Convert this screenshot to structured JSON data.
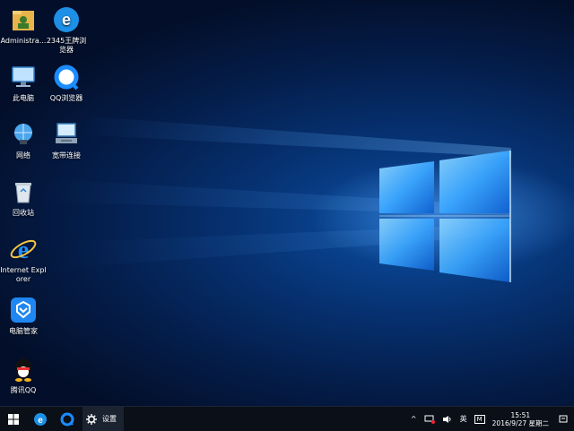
{
  "desktop": {
    "icons": [
      {
        "label": "Administra...",
        "icon": "user-folder-icon"
      },
      {
        "label": "2345王牌浏览器",
        "icon": "2345-browser-icon"
      },
      {
        "label": "此电脑",
        "icon": "computer-icon"
      },
      {
        "label": "QQ浏览器",
        "icon": "qq-browser-icon"
      },
      {
        "label": "网络",
        "icon": "network-icon"
      },
      {
        "label": "宽带连接",
        "icon": "broadband-icon"
      },
      {
        "label": "回收站",
        "icon": "recycle-bin-icon"
      },
      {
        "label": "Internet Explorer",
        "icon": "ie-icon"
      },
      {
        "label": "电脑管家",
        "icon": "pc-manager-icon"
      },
      {
        "label": "腾讯QQ",
        "icon": "qq-icon"
      }
    ]
  },
  "taskbar": {
    "start_icon": "windows-logo-icon",
    "pinned": [
      {
        "icon": "2345-browser-icon"
      },
      {
        "icon": "qq-browser-icon"
      }
    ],
    "settings_label": "设置",
    "tray": {
      "ime_label": "英",
      "ime2_label": "M",
      "time": "15:51",
      "date": "2016/9/27 星期二"
    }
  }
}
